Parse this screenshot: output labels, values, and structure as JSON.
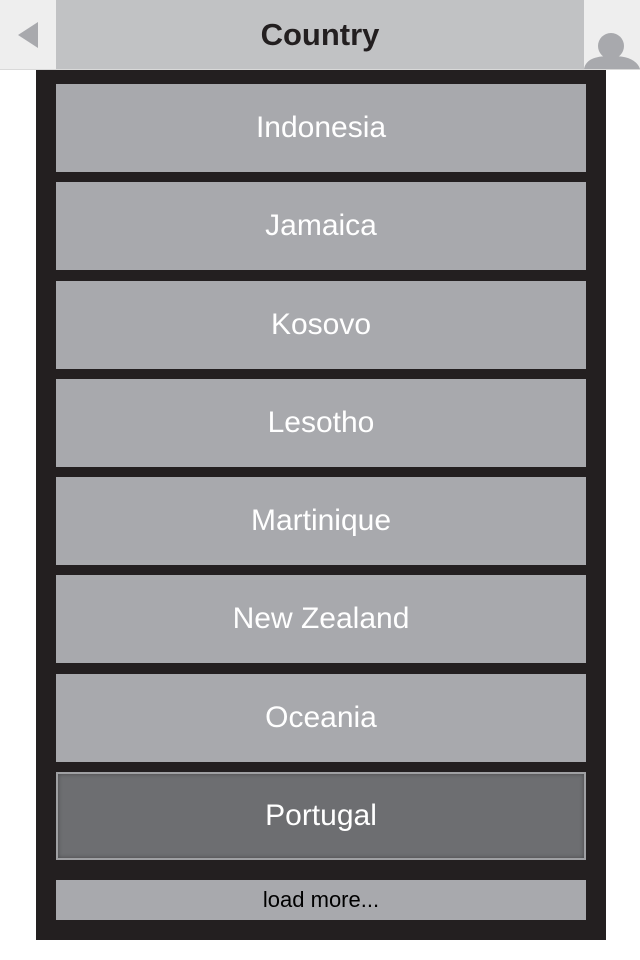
{
  "header": {
    "title": "Country",
    "back_icon": "back-arrow-icon",
    "profile_icon": "user-avatar-icon"
  },
  "countries": [
    {
      "label": "Indonesia",
      "selected": false
    },
    {
      "label": "Jamaica",
      "selected": false
    },
    {
      "label": "Kosovo",
      "selected": false
    },
    {
      "label": "Lesotho",
      "selected": false
    },
    {
      "label": "Martinique",
      "selected": false
    },
    {
      "label": "New Zealand",
      "selected": false
    },
    {
      "label": "Oceania",
      "selected": false
    },
    {
      "label": "Portugal",
      "selected": true
    }
  ],
  "load_more_label": "load more...",
  "colors": {
    "frame": "#231f20",
    "row": "#a8a9ad",
    "row_selected": "#6d6e71",
    "title_bar": "#c1c2c4"
  }
}
